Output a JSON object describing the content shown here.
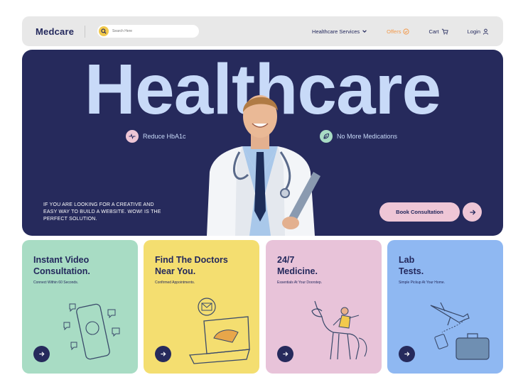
{
  "nav": {
    "brand": "Medcare",
    "search_placeholder": "Search Here",
    "services": "Healthcare Services",
    "offers": "Offers",
    "cart": "Cart",
    "login": "Login"
  },
  "hero": {
    "title": "Healthcare",
    "chip_left": "Reduce HbA1c",
    "chip_right": "No More Medications",
    "text": "IF YOU ARE LOOKING FOR A CREATIVE AND EASY WAY TO BUILD A WEBSITE. WOW! IS THE PERFECT SOLUTION.",
    "cta": "Book Consultation"
  },
  "cards": [
    {
      "title_1": "Instant Video",
      "title_2": "Consultation.",
      "sub": "Connect Within 60 Seconds.",
      "color": "#a8dcc4"
    },
    {
      "title_1": "Find The Doctors",
      "title_2": "Near You.",
      "sub": "Confirmed Appointments.",
      "color": "#f4de70"
    },
    {
      "title_1": "24/7",
      "title_2": "Medicine.",
      "sub": "Essentials At Your Doorstep.",
      "color": "#e8c3d9"
    },
    {
      "title_1": "Lab",
      "title_2": "Tests.",
      "sub": "Simple Pickup At Your Home.",
      "color": "#8fb8f2"
    }
  ],
  "colors": {
    "navy": "#262a5c",
    "pale_blue": "#c8daf8",
    "pink": "#eec6d6",
    "orange": "#f2994a"
  }
}
